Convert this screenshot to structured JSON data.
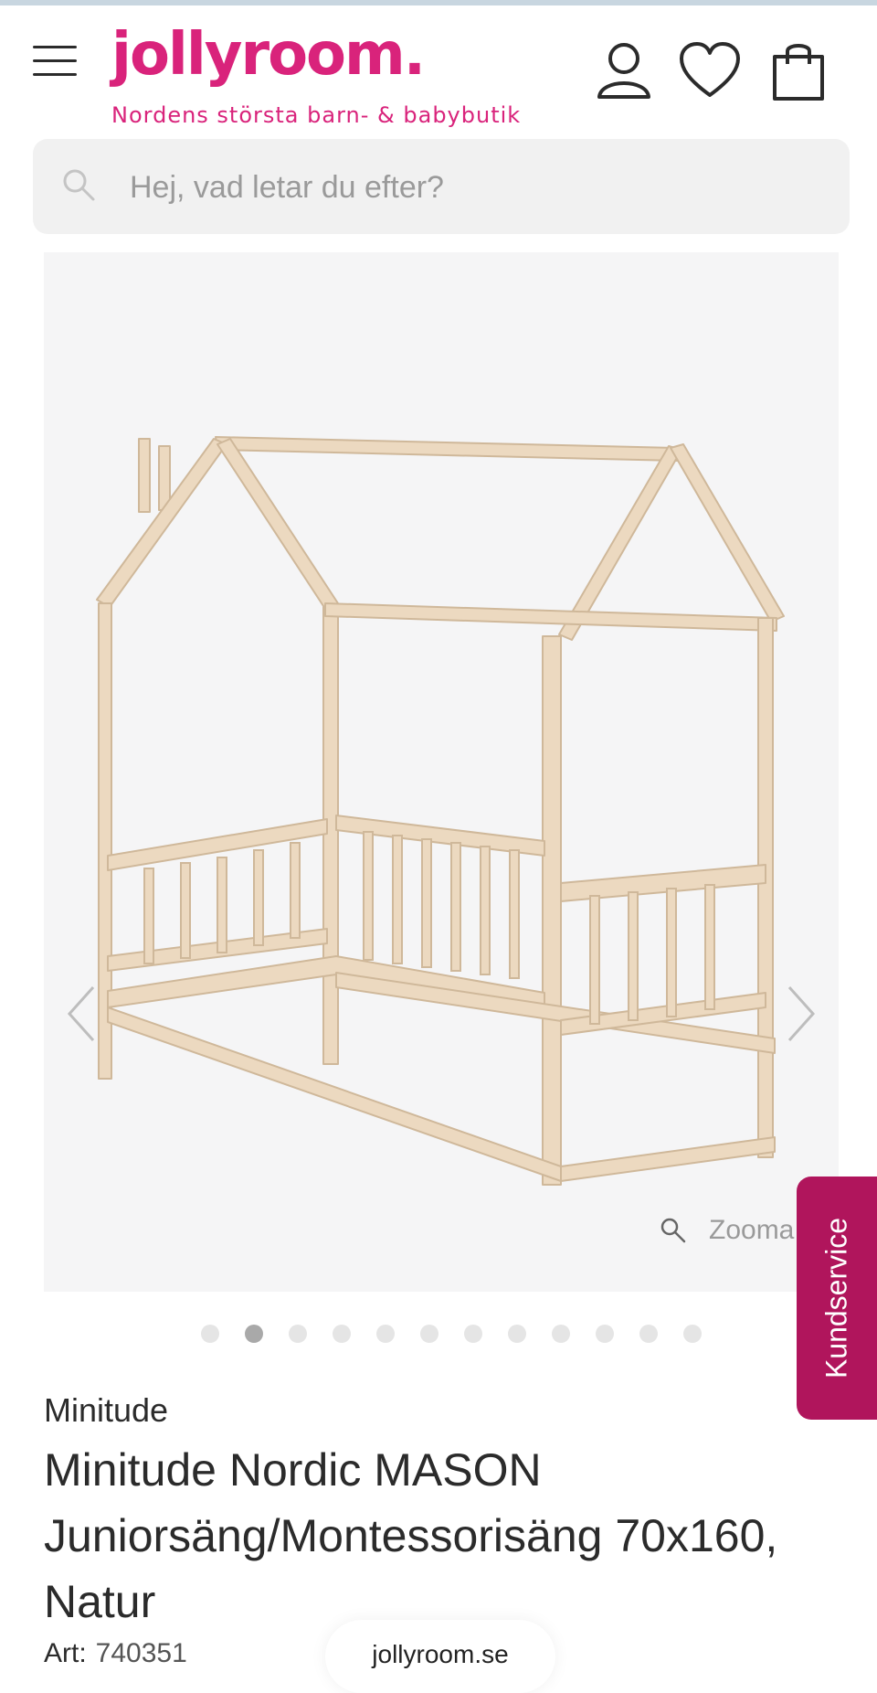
{
  "header": {
    "logo": "jollyroom.",
    "tagline": "Nordens största barn- & babybutik"
  },
  "search": {
    "placeholder": "Hej, vad letar du efter?"
  },
  "gallery": {
    "zoom_label": "Zooma",
    "dots_total": 12,
    "active_dot_index": 1
  },
  "side_tab": {
    "label": "Kundservice"
  },
  "product": {
    "brand": "Minitude",
    "title_lines": [
      "Minitude Nordic MASON",
      "Juniorsäng/Montessorisäng 70x160,",
      "Natur"
    ],
    "art_label": "Art:",
    "art_number": "740351"
  },
  "browser": {
    "url": "jollyroom.se"
  },
  "colors": {
    "brand_pink": "#d9237b",
    "kundservice_bg": "#b0155c",
    "search_bg": "#f1f1f1",
    "gallery_bg": "#f5f5f6",
    "wood": "#ecd9c0"
  },
  "icons": [
    "menu-icon",
    "user-icon",
    "heart-icon",
    "bag-icon",
    "search-icon",
    "chevron-left-icon",
    "chevron-right-icon",
    "magnifier-icon"
  ]
}
